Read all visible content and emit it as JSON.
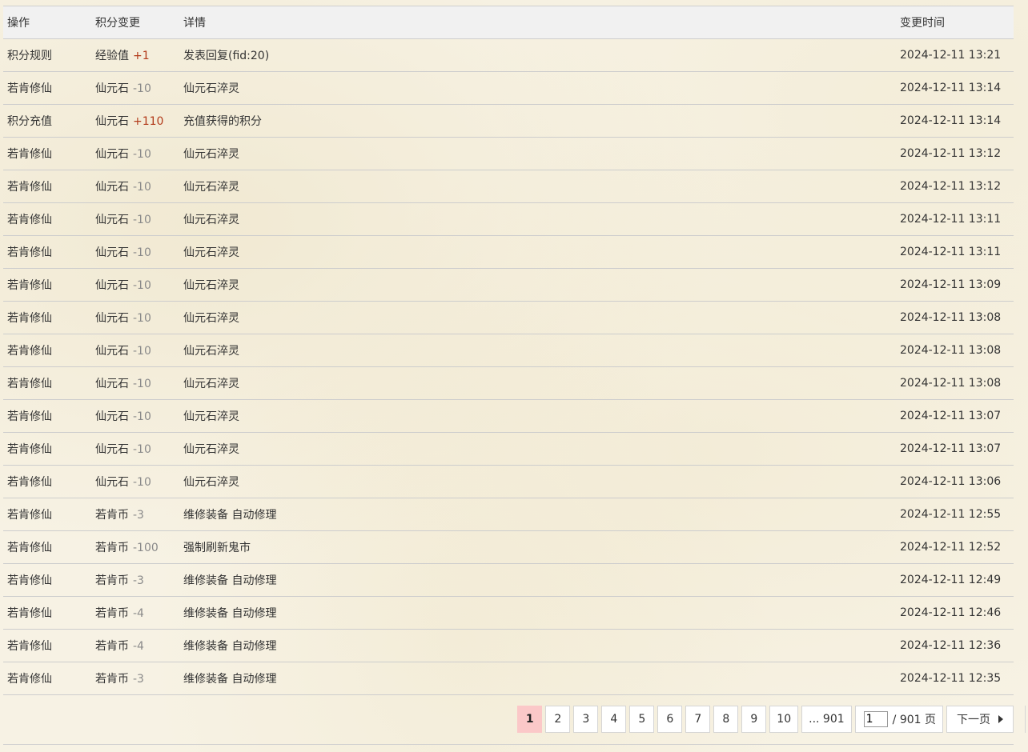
{
  "table": {
    "headers": {
      "operation": "操作",
      "change": "积分变更",
      "detail": "详情",
      "time": "变更时间"
    },
    "rows": [
      {
        "operation": "积分规则",
        "credit": "经验值",
        "amount": "+1",
        "detail": "发表回复(fid:20)",
        "time": "2024-12-11 13:21"
      },
      {
        "operation": "若肯修仙",
        "credit": "仙元石",
        "amount": "-10",
        "detail": "仙元石淬灵",
        "time": "2024-12-11 13:14"
      },
      {
        "operation": "积分充值",
        "credit": "仙元石",
        "amount": "+110",
        "detail": "充值获得的积分",
        "time": "2024-12-11 13:14"
      },
      {
        "operation": "若肯修仙",
        "credit": "仙元石",
        "amount": "-10",
        "detail": "仙元石淬灵",
        "time": "2024-12-11 13:12"
      },
      {
        "operation": "若肯修仙",
        "credit": "仙元石",
        "amount": "-10",
        "detail": "仙元石淬灵",
        "time": "2024-12-11 13:12"
      },
      {
        "operation": "若肯修仙",
        "credit": "仙元石",
        "amount": "-10",
        "detail": "仙元石淬灵",
        "time": "2024-12-11 13:11"
      },
      {
        "operation": "若肯修仙",
        "credit": "仙元石",
        "amount": "-10",
        "detail": "仙元石淬灵",
        "time": "2024-12-11 13:11"
      },
      {
        "operation": "若肯修仙",
        "credit": "仙元石",
        "amount": "-10",
        "detail": "仙元石淬灵",
        "time": "2024-12-11 13:09"
      },
      {
        "operation": "若肯修仙",
        "credit": "仙元石",
        "amount": "-10",
        "detail": "仙元石淬灵",
        "time": "2024-12-11 13:08"
      },
      {
        "operation": "若肯修仙",
        "credit": "仙元石",
        "amount": "-10",
        "detail": "仙元石淬灵",
        "time": "2024-12-11 13:08"
      },
      {
        "operation": "若肯修仙",
        "credit": "仙元石",
        "amount": "-10",
        "detail": "仙元石淬灵",
        "time": "2024-12-11 13:08"
      },
      {
        "operation": "若肯修仙",
        "credit": "仙元石",
        "amount": "-10",
        "detail": "仙元石淬灵",
        "time": "2024-12-11 13:07"
      },
      {
        "operation": "若肯修仙",
        "credit": "仙元石",
        "amount": "-10",
        "detail": "仙元石淬灵",
        "time": "2024-12-11 13:07"
      },
      {
        "operation": "若肯修仙",
        "credit": "仙元石",
        "amount": "-10",
        "detail": "仙元石淬灵",
        "time": "2024-12-11 13:06"
      },
      {
        "operation": "若肯修仙",
        "credit": "若肯币",
        "amount": "-3",
        "detail": "维修装备 自动修理",
        "time": "2024-12-11 12:55"
      },
      {
        "operation": "若肯修仙",
        "credit": "若肯币",
        "amount": "-100",
        "detail": "强制刷新鬼市",
        "time": "2024-12-11 12:52"
      },
      {
        "operation": "若肯修仙",
        "credit": "若肯币",
        "amount": "-3",
        "detail": "维修装备 自动修理",
        "time": "2024-12-11 12:49"
      },
      {
        "operation": "若肯修仙",
        "credit": "若肯币",
        "amount": "-4",
        "detail": "维修装备 自动修理",
        "time": "2024-12-11 12:46"
      },
      {
        "operation": "若肯修仙",
        "credit": "若肯币",
        "amount": "-4",
        "detail": "维修装备 自动修理",
        "time": "2024-12-11 12:36"
      },
      {
        "operation": "若肯修仙",
        "credit": "若肯币",
        "amount": "-3",
        "detail": "维修装备 自动修理",
        "time": "2024-12-11 12:35"
      }
    ]
  },
  "pagination": {
    "pages": [
      "1",
      "2",
      "3",
      "4",
      "5",
      "6",
      "7",
      "8",
      "9",
      "10"
    ],
    "current": "1",
    "last_link": "... 901",
    "jump_value": "1",
    "total_label": "/ 901 页",
    "next_label": "下一页"
  },
  "colors": {
    "positive_amount": "#b23a1a",
    "negative_amount": "#8a8a8a",
    "current_page_bg": "#fbc8c8",
    "header_bg": "#f1f1f1"
  }
}
